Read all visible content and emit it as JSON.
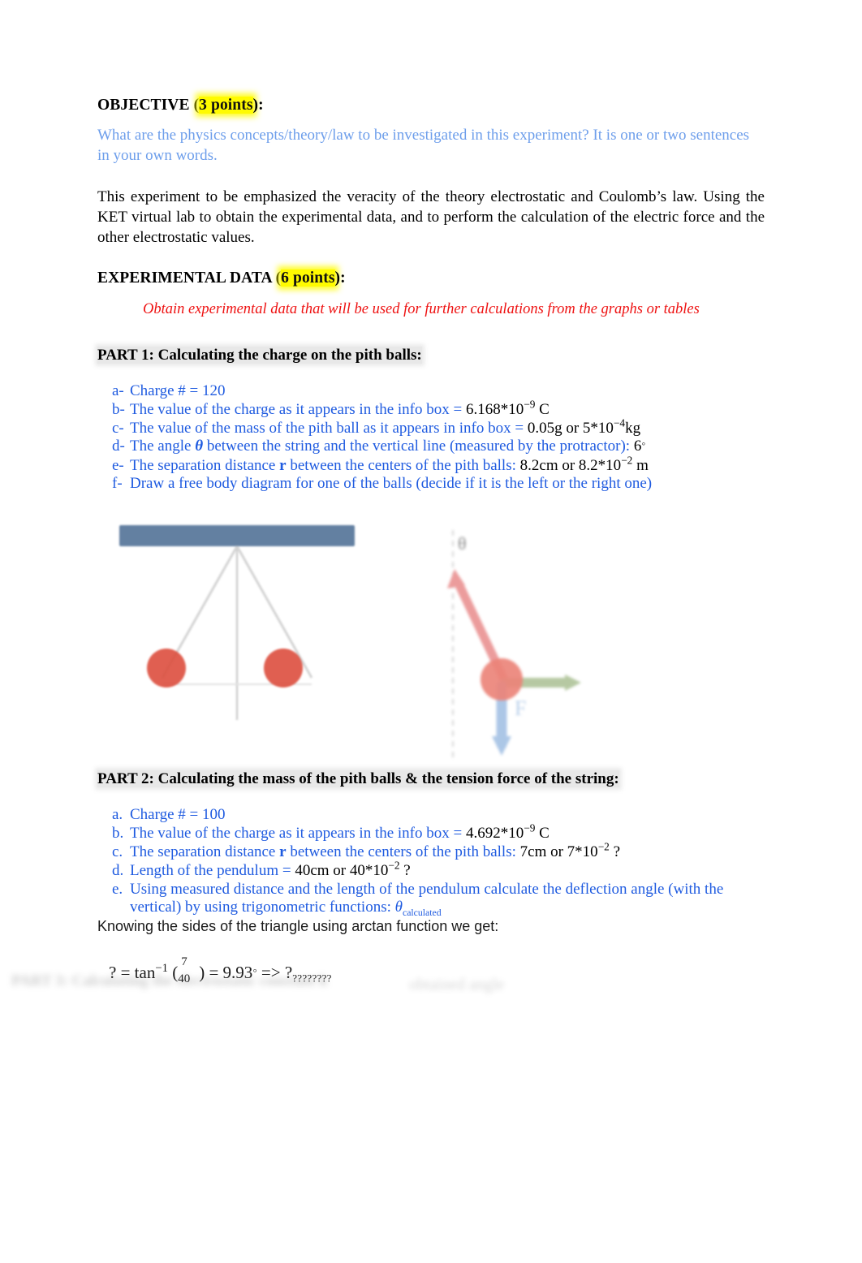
{
  "document": {
    "objective": {
      "heading_main": "OBJECTIVE (",
      "heading_points": "3 points",
      "heading_tail": "):",
      "prompt": "What are the physics concepts/theory/law to be investigated in this experiment?   It is one or two sentences in your own words.",
      "answer": "This experiment to be emphasized the veracity of the theory electrostatic and Coulomb’s law. Using the KET virtual lab to obtain the experimental data, and to perform the calculation of the electric force and the other electrostatic values."
    },
    "experimental_data": {
      "heading_main": "EXPERIMENTAL DATA (",
      "heading_points": "6 points",
      "heading_tail": "):",
      "instruction": "Obtain experimental data that will be used for further calculations from the graphs or tables"
    },
    "part1": {
      "heading": "PART 1: Calculating the charge on the pith balls:",
      "items": [
        {
          "marker": "a-",
          "pre": "Charge # = 120",
          "black": "",
          "post": ""
        },
        {
          "marker": "b-",
          "pre": "The value of the charge as it appears in the info box = ",
          "black": "6.168*10",
          "exp": "−9",
          "black2": " C",
          "post": ""
        },
        {
          "marker": "c-",
          "pre": "The value of the mass of the pith ball as it appears in info box = ",
          "black": "0.05g or 5*10",
          "exp": "−4",
          "black2": "kg",
          "post": ""
        },
        {
          "marker": "d-",
          "pre": "The angle ",
          "sym": "θ",
          "mid": " between the string and the vertical line (measured by the protractor): ",
          "black": "6",
          "deg": "◦",
          "post": ""
        },
        {
          "marker": "e-",
          "pre": "The separation distance ",
          "sym": "r",
          "mid": " between the centers of the pith balls: ",
          "black": "8.2cm or 8.2*10",
          "exp": "−2",
          "black2": " m",
          "post": ""
        },
        {
          "marker": "f-",
          "pre": "Draw a free body diagram for one of the balls (decide if it is the left or the right one)",
          "black": "",
          "post": ""
        }
      ]
    },
    "figures": {
      "pith_balls": {
        "caption": "two pith balls hanging from a horizontal support bar",
        "bar_color": "#5b7a9d",
        "ball_color": "#d9402f"
      },
      "free_body": {
        "caption": "free body diagram of one pith ball",
        "tension_color": "#e06060",
        "electric_force_color": "#8aa86a",
        "weight_color": "#7aa5d8",
        "weight_label": "F"
      }
    },
    "part2": {
      "heading": "PART 2: Calculating the mass of the pith balls & the tension force of the string:",
      "items": [
        {
          "marker": "a.",
          "pre": "Charge # = 100",
          "black": "",
          "post": ""
        },
        {
          "marker": "b.",
          "pre": "The value of the charge as it appears in the info box = ",
          "black": "4.692*10",
          "exp": "−9",
          "black2": " C",
          "post": ""
        },
        {
          "marker": "c.",
          "pre": "The separation distance ",
          "sym": "r",
          "mid": " between the centers of the pith balls: ",
          "black": "7cm or 7*10",
          "exp": "−2",
          "black2": " ?",
          "post": ""
        },
        {
          "marker": "d.",
          "pre": "Length of the pendulum = ",
          "black": "40cm or 40*10",
          "exp": "−2",
          "black2": " ?",
          "post": ""
        },
        {
          "marker": "e.",
          "pre": "Using measured distance and the length of the pendulum calculate the deflection angle (with the vertical) by using trigonometric functions: ",
          "sym_theta": "θ",
          "sub": "calculated",
          "black": "",
          "post": ""
        }
      ],
      "sans_line": "Knowing the sides of the triangle using arctan function we get:",
      "equation": {
        "lhs": "? = tan",
        "exponent": "−1",
        "paren_open": "(",
        "numerator": "7",
        "denominator": "40",
        "paren_close": ")",
        "equals": "= 9.93",
        "degree": "◦",
        "arrow": "=> ?",
        "question_marks": "????????",
        "faded_tail": "obtained      angle"
      }
    },
    "faded_footer": "PART 3:  Calculating the electrostatic constant    k"
  }
}
